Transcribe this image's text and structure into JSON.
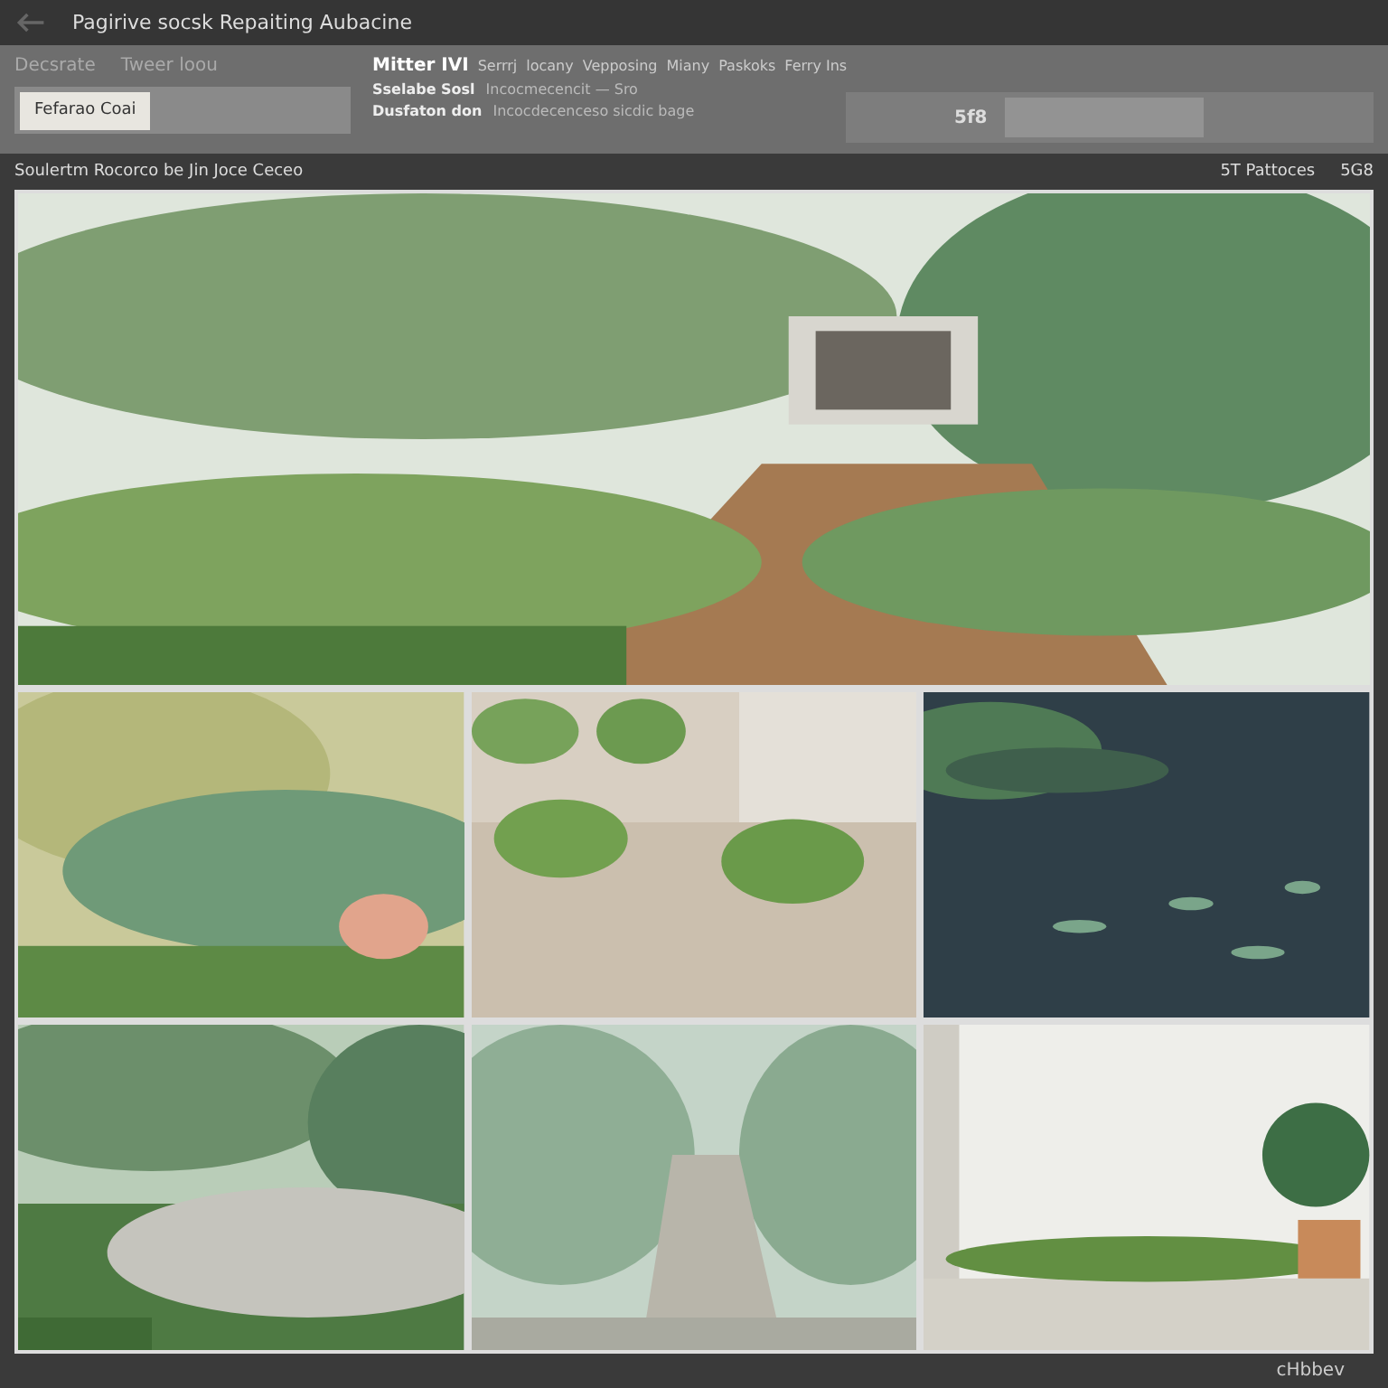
{
  "window": {
    "title": "Pagirive socsk Repaiting Aubacine"
  },
  "toolbar": {
    "labels": [
      "Decsrate",
      "Tweer loou"
    ],
    "button": "Fefarao Coai",
    "heading": "Mitter IVI",
    "links": [
      "Serrrj",
      "locany",
      "Vepposing",
      "Miany",
      "Paskoks",
      "Ferry Ins"
    ],
    "info": [
      {
        "name": "Sselabe Sosl",
        "value": "Incocmecencit — Sro"
      },
      {
        "name": "Dusfaton don",
        "value": "Incocdecenceso sicdic bage"
      }
    ],
    "size_label": "5f8"
  },
  "status_bar": {
    "left": "Soulertm Rocorco be Jin Joce Ceceo",
    "right": [
      "5T Pattoces",
      "5G8"
    ]
  },
  "footer": "cHbbev"
}
